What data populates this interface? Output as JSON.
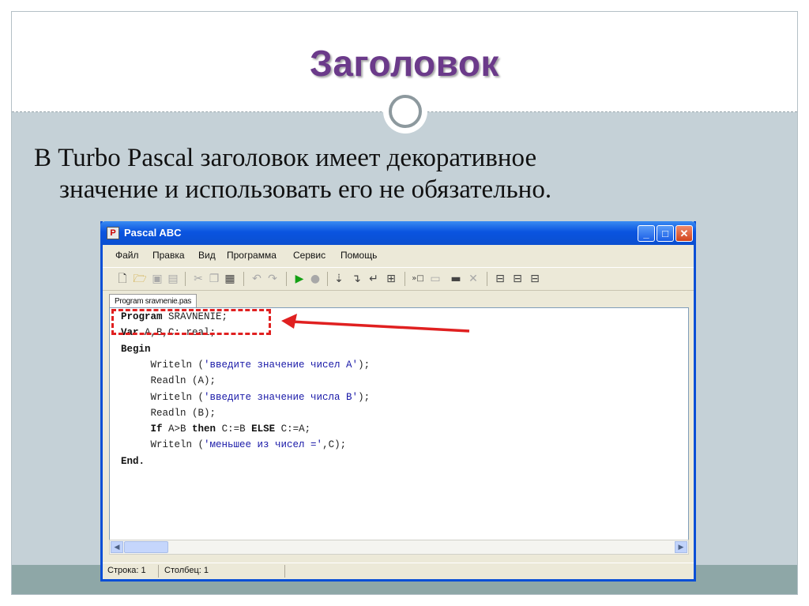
{
  "slide": {
    "title": "Заголовок",
    "text_line1": "В Turbo Pascal заголовок имеет декоративное",
    "text_line2": "значение и использовать его не обязательно."
  },
  "window": {
    "title": "Pascal ABC",
    "icon_glyph": "P",
    "buttons": {
      "minimize": "_",
      "maximize": "□",
      "close": "✕"
    },
    "menu": [
      "Файл",
      "Правка",
      "Вид",
      "Программа",
      "Сервис",
      "Помощь"
    ],
    "tab_label": "Program sravnenie.pas",
    "code": [
      [
        {
          "t": "Program",
          "c": "kw"
        },
        {
          "t": " SRAVNENIE;",
          "c": ""
        }
      ],
      [
        {
          "t": "Var",
          "c": "kw"
        },
        {
          "t": " A,B,C: real;",
          "c": ""
        }
      ],
      [
        {
          "t": "Begin",
          "c": "kw"
        }
      ],
      [
        {
          "t": "     Writeln (",
          "c": ""
        },
        {
          "t": "'введите значение чисел A'",
          "c": "str"
        },
        {
          "t": ");",
          "c": ""
        }
      ],
      [
        {
          "t": "     Readln (A);",
          "c": ""
        }
      ],
      [
        {
          "t": "     Writeln (",
          "c": ""
        },
        {
          "t": "'введите значение числа B'",
          "c": "str"
        },
        {
          "t": ");",
          "c": ""
        }
      ],
      [
        {
          "t": "     Readln (B);",
          "c": ""
        }
      ],
      [
        {
          "t": "     ",
          "c": ""
        },
        {
          "t": "If",
          "c": "kw"
        },
        {
          "t": " A>B ",
          "c": ""
        },
        {
          "t": "then",
          "c": "kw"
        },
        {
          "t": " C:=B ",
          "c": ""
        },
        {
          "t": "ELSE",
          "c": "kw"
        },
        {
          "t": " C:=A;",
          "c": ""
        }
      ],
      [
        {
          "t": "     Writeln (",
          "c": ""
        },
        {
          "t": "'меньшее из чисел ='",
          "c": "str"
        },
        {
          "t": ",C);",
          "c": ""
        }
      ],
      [
        {
          "t": "End.",
          "c": "kw"
        }
      ]
    ],
    "status": {
      "row": "Строка: 1",
      "col": "Столбец: 1"
    }
  },
  "icons": {
    "new": "new-file-icon",
    "open": "open-folder-icon",
    "save": "save-icon",
    "run": "run-icon",
    "stop": "stop-icon"
  },
  "colors": {
    "title": "#6b3a8a",
    "annotation": "#e02020",
    "titlebar": "#0a54e0"
  }
}
